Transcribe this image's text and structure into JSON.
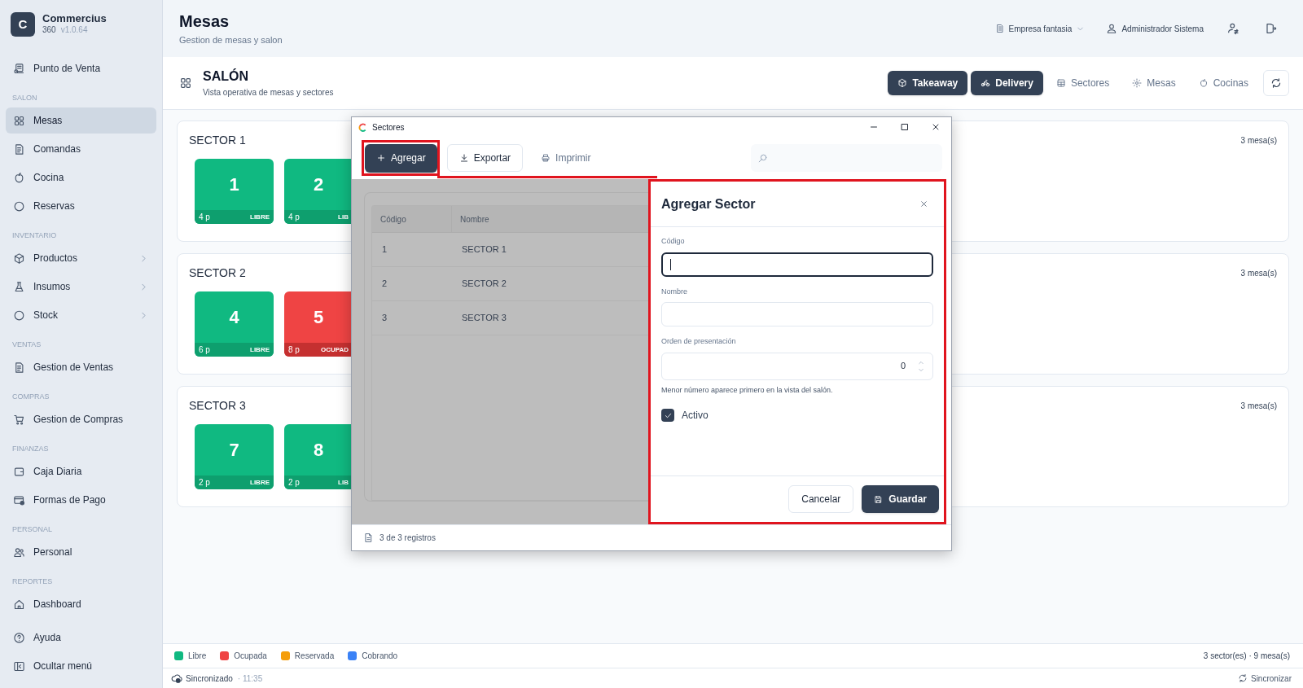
{
  "sidebar": {
    "logo_letter": "C",
    "app_name": "Commercius",
    "edition": "360",
    "version": "v1.0.64",
    "sections": [
      {
        "items": [
          {
            "label": "Punto de Venta",
            "selected": false,
            "has_submenu": false
          }
        ]
      },
      {
        "heading": "SALON",
        "items": [
          {
            "label": "Mesas",
            "selected": true,
            "has_submenu": false
          },
          {
            "label": "Comandas",
            "selected": false,
            "has_submenu": false
          },
          {
            "label": "Cocina",
            "selected": false,
            "has_submenu": false
          },
          {
            "label": "Reservas",
            "selected": false,
            "has_submenu": false
          }
        ]
      },
      {
        "heading": "INVENTARIO",
        "items": [
          {
            "label": "Productos",
            "selected": false,
            "has_submenu": true
          },
          {
            "label": "Insumos",
            "selected": false,
            "has_submenu": true
          },
          {
            "label": "Stock",
            "selected": false,
            "has_submenu": true
          }
        ]
      },
      {
        "heading": "VENTAS",
        "items": [
          {
            "label": "Gestion de Ventas",
            "selected": false,
            "has_submenu": false
          }
        ]
      },
      {
        "heading": "COMPRAS",
        "items": [
          {
            "label": "Gestion de Compras",
            "selected": false,
            "has_submenu": false
          }
        ]
      },
      {
        "heading": "FINANZAS",
        "items": [
          {
            "label": "Caja Diaria",
            "selected": false,
            "has_submenu": false
          },
          {
            "label": "Formas de Pago",
            "selected": false,
            "has_submenu": false
          }
        ]
      },
      {
        "heading": "PERSONAL",
        "items": [
          {
            "label": "Personal",
            "selected": false,
            "has_submenu": false
          }
        ]
      },
      {
        "heading": "REPORTES",
        "items": [
          {
            "label": "Dashboard",
            "selected": false,
            "has_submenu": false
          }
        ]
      }
    ],
    "footer_items": [
      {
        "label": "Ayuda"
      },
      {
        "label": "Ocultar menú"
      }
    ]
  },
  "header": {
    "title": "Mesas",
    "subtitle": "Gestion de mesas y salon",
    "company": "Empresa fantasia",
    "user": "Administrador Sistema"
  },
  "salon": {
    "title": "SALÓN",
    "subtitle": "Vista operativa de mesas y sectores",
    "actions": [
      {
        "label": "Takeaway",
        "kind": "primary"
      },
      {
        "label": "Delivery",
        "kind": "primary"
      },
      {
        "label": "Sectores",
        "kind": "ghost"
      },
      {
        "label": "Mesas",
        "kind": "ghost"
      },
      {
        "label": "Cocinas",
        "kind": "ghost"
      }
    ]
  },
  "sectors": [
    {
      "name": "SECTOR 1",
      "count": "3 mesa(s)",
      "tables": [
        {
          "number": "1",
          "people": "4 p",
          "status": "LIBRE",
          "kind": "free"
        },
        {
          "number": "2",
          "people": "4 p",
          "status": "LIB",
          "kind": "free"
        }
      ]
    },
    {
      "name": "SECTOR 2",
      "count": "3 mesa(s)",
      "tables": [
        {
          "number": "4",
          "people": "6 p",
          "status": "LIBRE",
          "kind": "free"
        },
        {
          "number": "5",
          "people": "8 p",
          "status": "OCUPAD",
          "kind": "occupied"
        }
      ]
    },
    {
      "name": "SECTOR 3",
      "count": "3 mesa(s)",
      "tables": [
        {
          "number": "7",
          "people": "2 p",
          "status": "LIBRE",
          "kind": "free"
        },
        {
          "number": "8",
          "people": "2 p",
          "status": "LIB",
          "kind": "free"
        }
      ]
    }
  ],
  "dialog": {
    "title": "Sectores",
    "toolbar": [
      {
        "label": "Agregar",
        "kind": "primary",
        "highlighted": true
      },
      {
        "label": "Exportar",
        "kind": "outline",
        "highlighted": false
      },
      {
        "label": "Imprimir",
        "kind": "ghost",
        "highlighted": false
      }
    ],
    "table": {
      "columns": [
        "Código",
        "Nombre"
      ],
      "rows": [
        [
          "1",
          "SECTOR 1"
        ],
        [
          "2",
          "SECTOR 2"
        ],
        [
          "3",
          "SECTOR 3"
        ]
      ]
    },
    "form": {
      "title": "Agregar Sector",
      "highlighted": true,
      "fields": [
        {
          "label": "Código",
          "kind": "text",
          "focused": true
        },
        {
          "label": "Nombre",
          "kind": "text",
          "focused": false
        },
        {
          "label": "Orden de presentación",
          "kind": "number",
          "focused": false,
          "value": "0",
          "hint": "Menor número aparece primero en la vista del salón."
        }
      ],
      "checkbox": {
        "label": "Activo",
        "checked": true
      },
      "buttons": [
        {
          "label": "Cancelar",
          "kind": "outline"
        },
        {
          "label": "Guardar",
          "kind": "primary"
        }
      ]
    },
    "footer": "3 de 3 registros"
  },
  "legend": [
    {
      "label": "Libre",
      "color": "#10b981"
    },
    {
      "label": "Ocupada",
      "color": "#ef4444"
    },
    {
      "label": "Reservada",
      "color": "#f59e0b"
    },
    {
      "label": "Cobrando",
      "color": "#3b82f6"
    }
  ],
  "summary": "3 sector(es) · 9 mesa(s)",
  "status_bar": {
    "sync_state": "Sincronizado",
    "time": "· 11:35",
    "action": "Sincronizar"
  }
}
